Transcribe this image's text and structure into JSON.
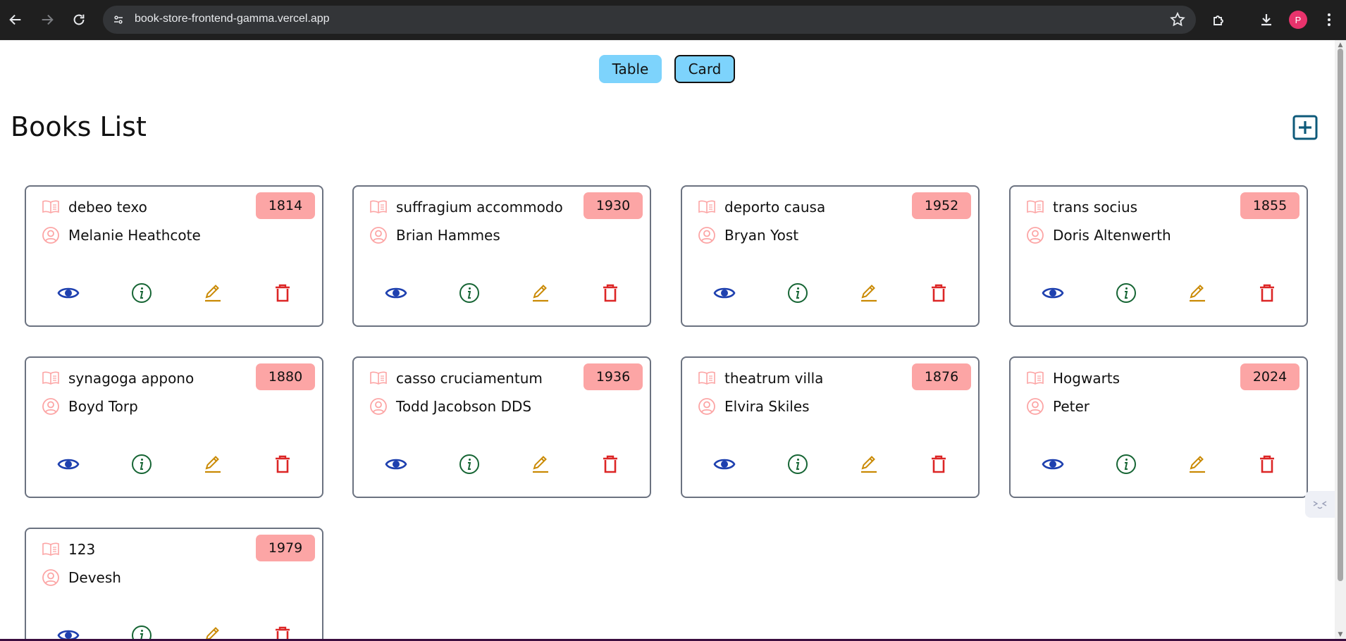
{
  "browser": {
    "url": "book-store-frontend-gamma.vercel.app",
    "profile_initial": "P",
    "icons": [
      "back-icon",
      "forward-icon",
      "reload-icon",
      "site-info-icon",
      "bookmark-star-icon",
      "extensions-icon",
      "downloads-icon",
      "menu-icon"
    ]
  },
  "view_toggle": {
    "table_label": "Table",
    "card_label": "Card",
    "active": "Card"
  },
  "page": {
    "title": "Books List",
    "add_icon": "plus-square-icon"
  },
  "colors": {
    "toggle_bg": "#7dd3fc",
    "badge_bg": "#fca5a5",
    "show_icon": "#1e40af",
    "info_icon": "#166534",
    "edit_icon": "#ca8a04",
    "delete_icon": "#dc2626",
    "card_icon": "#fca5a5",
    "add_icon": "#0e5a7a"
  },
  "books": [
    {
      "title": "debeo texo",
      "author": "Melanie Heathcote",
      "year": "1814"
    },
    {
      "title": "suffragium accommodo",
      "author": "Brian Hammes",
      "year": "1930"
    },
    {
      "title": "deporto causa",
      "author": "Bryan Yost",
      "year": "1952"
    },
    {
      "title": "trans socius",
      "author": "Doris Altenwerth",
      "year": "1855"
    },
    {
      "title": "synagoga appono",
      "author": "Boyd Torp",
      "year": "1880"
    },
    {
      "title": "casso cruciamentum",
      "author": "Todd Jacobson DDS",
      "year": "1936"
    },
    {
      "title": "theatrum villa",
      "author": "Elvira Skiles",
      "year": "1876"
    },
    {
      "title": "Hogwarts",
      "author": "Peter",
      "year": "2024"
    },
    {
      "title": "123",
      "author": "Devesh",
      "year": "1979"
    }
  ],
  "card_icons": [
    "book-open-icon",
    "user-circle-icon",
    "eye-icon",
    "info-circle-icon",
    "pencil-icon",
    "trash-icon"
  ]
}
